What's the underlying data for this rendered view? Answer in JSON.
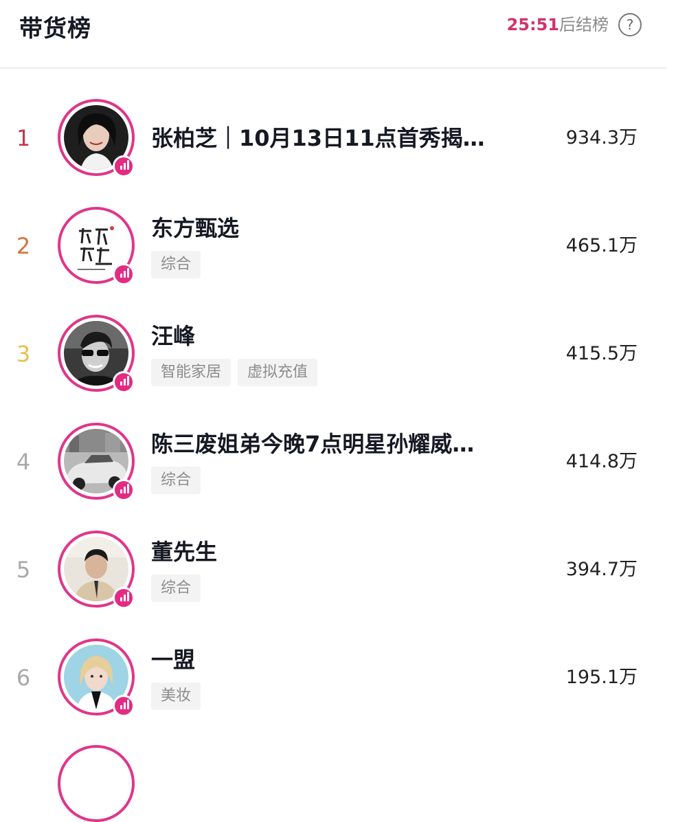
{
  "header": {
    "title": "带货榜",
    "countdown_time": "25:51",
    "countdown_suffix": "后结榜",
    "help_icon_glyph": "?"
  },
  "colors": {
    "accent": "#e0358a",
    "countdown": "#d0336c",
    "rank_1": "#c8344b",
    "rank_2": "#d4733e",
    "rank_3": "#e8c04a",
    "rank_other": "#a8a8a8"
  },
  "rows": [
    {
      "rank": "1",
      "name": "张柏芝｜10月13日11点首秀揭…",
      "tags": [],
      "value": "934.3万",
      "avatar": "portrait-woman-dark"
    },
    {
      "rank": "2",
      "name": "东方甄选",
      "tags": [
        "综合"
      ],
      "value": "465.1万",
      "avatar": "logo-calligraphy"
    },
    {
      "rank": "3",
      "name": "汪峰",
      "tags": [
        "智能家居",
        "虚拟充值"
      ],
      "value": "415.5万",
      "avatar": "portrait-man-sunglasses"
    },
    {
      "rank": "4",
      "name": "陈三废姐弟今晚7点明星孙耀威…",
      "tags": [
        "综合"
      ],
      "value": "414.8万",
      "avatar": "photo-car"
    },
    {
      "rank": "5",
      "name": "董先生",
      "tags": [
        "综合"
      ],
      "value": "394.7万",
      "avatar": "portrait-man-suit"
    },
    {
      "rank": "6",
      "name": "一盟",
      "tags": [
        "美妆"
      ],
      "value": "195.1万",
      "avatar": "portrait-woman-blonde"
    }
  ]
}
